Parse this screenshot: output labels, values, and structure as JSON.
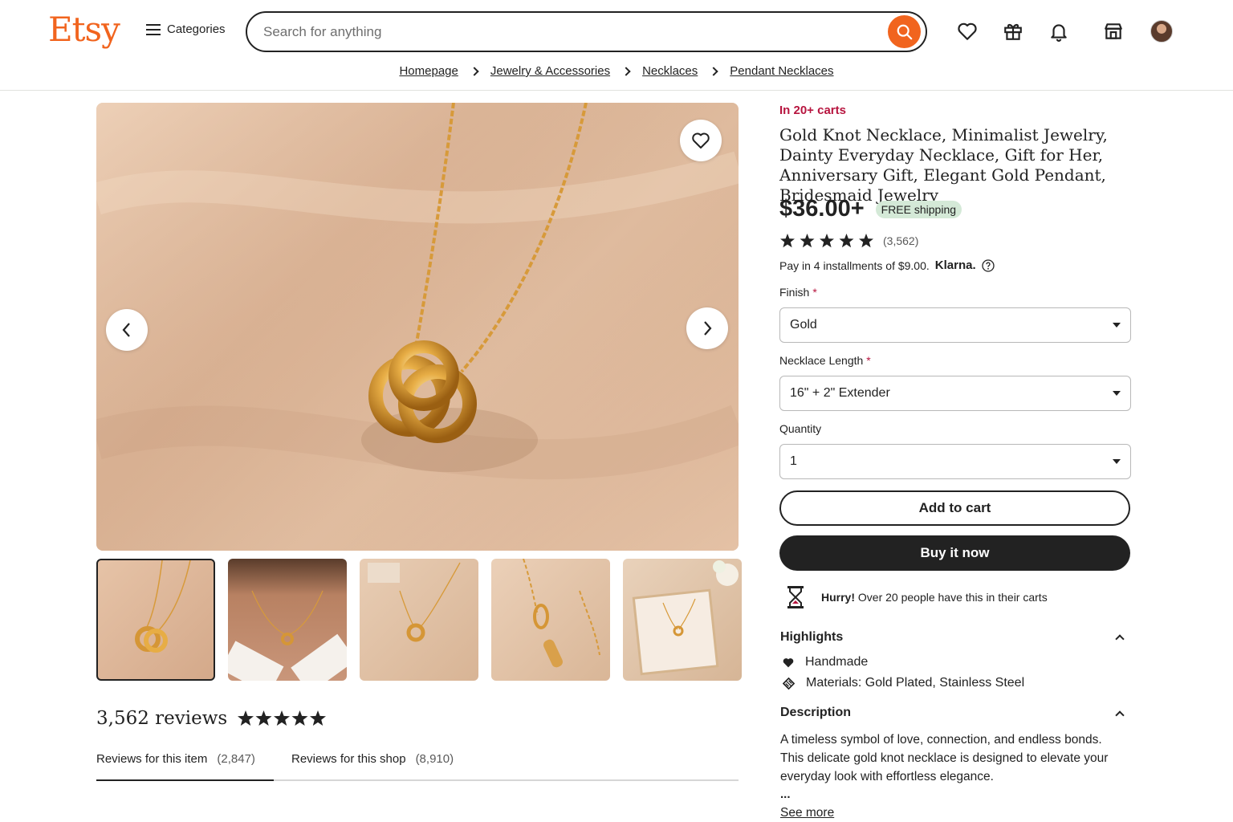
{
  "header": {
    "logo": "Etsy",
    "categories_label": "Categories",
    "search_placeholder": "Search for anything"
  },
  "breadcrumb": [
    "Homepage",
    "Jewelry & Accessories",
    "Necklaces",
    "Pendant Necklaces"
  ],
  "product": {
    "badge": "In 20+ carts",
    "title": "Gold Knot Necklace, Minimalist Jewelry, Dainty Everyday Necklace, Gift for Her, Anniversary Gift, Elegant Gold Pendant, Bridesmaid Jewelry",
    "price": "$36.00+",
    "shipping": "FREE shipping",
    "rating": 5,
    "rating_count": "(3,562)",
    "installments": "Pay in 4 installments of $9.00.",
    "klarna": "Klarna.",
    "options": {
      "finish_label": "Finish",
      "finish_value": "Gold",
      "length_label": "Necklace Length",
      "length_value": "16\" + 2\" Extender",
      "quantity_label": "Quantity",
      "quantity_value": "1",
      "required_mark": "*"
    },
    "add_to_cart": "Add to cart",
    "buy_now": "Buy it now",
    "hurry_bold": "Hurry!",
    "hurry_text": " Over 20 people have this in their carts",
    "highlights_title": "Highlights",
    "highlights": [
      "Handmade",
      "Materials: Gold Plated, Stainless Steel"
    ],
    "description_title": "Description",
    "description": "A timeless symbol of love, connection, and endless bonds. This delicate gold knot necklace is designed to elevate your everyday look with effortless elegance.",
    "ellipsis": "...",
    "see_more": "See more"
  },
  "reviews": {
    "title": "3,562 reviews",
    "tab_item": "Reviews for this item",
    "tab_item_count": "(2,847)",
    "tab_shop": "Reviews for this shop",
    "tab_shop_count": "(8,910)"
  },
  "colors": {
    "brand": "#f1641e",
    "badge": "#b7153f",
    "shipping_bg": "#d4e9d7"
  }
}
